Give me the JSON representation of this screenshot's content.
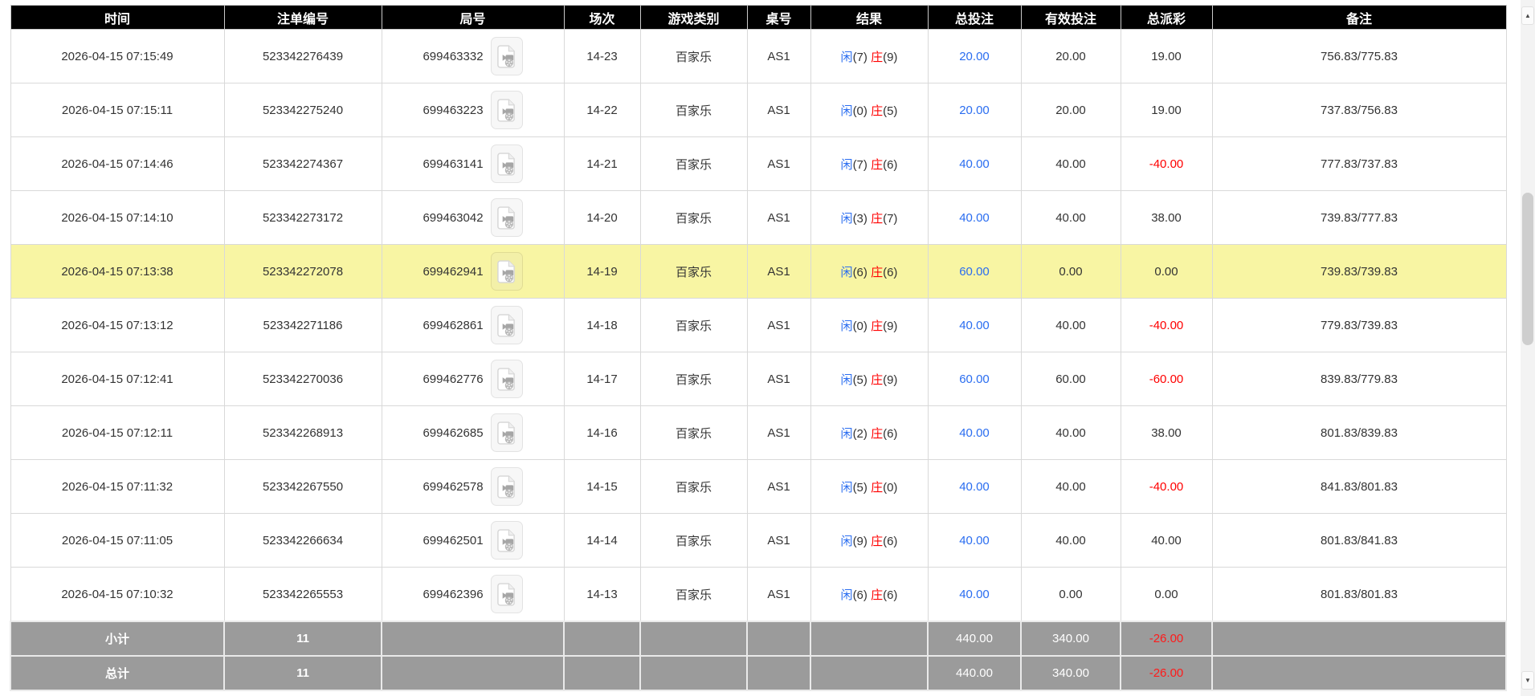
{
  "header": {
    "columns": [
      {
        "key": "time",
        "label": "时间"
      },
      {
        "key": "bet_id",
        "label": "注单编号"
      },
      {
        "key": "round_id",
        "label": "局号"
      },
      {
        "key": "session",
        "label": "场次"
      },
      {
        "key": "game_type",
        "label": "游戏类别"
      },
      {
        "key": "table_no",
        "label": "桌号"
      },
      {
        "key": "result",
        "label": "结果"
      },
      {
        "key": "total_bet",
        "label": "总投注"
      },
      {
        "key": "valid_bet",
        "label": "有效投注"
      },
      {
        "key": "total_payout",
        "label": "总派彩"
      },
      {
        "key": "remark",
        "label": "备注"
      }
    ]
  },
  "rows": [
    {
      "time": "2026-04-15 07:15:49",
      "bet_id": "523342276439",
      "round_id": "699463332",
      "session": "14-23",
      "game_type": "百家乐",
      "table_no": "AS1",
      "result": {
        "player": "闲",
        "player_score": "(7)",
        "banker": "庄",
        "banker_score": "(9)"
      },
      "total_bet": "20.00",
      "valid_bet": "20.00",
      "total_payout": "19.00",
      "remark": "756.83/775.83",
      "highlighted": false
    },
    {
      "time": "2026-04-15 07:15:11",
      "bet_id": "523342275240",
      "round_id": "699463223",
      "session": "14-22",
      "game_type": "百家乐",
      "table_no": "AS1",
      "result": {
        "player": "闲",
        "player_score": "(0)",
        "banker": "庄",
        "banker_score": "(5)"
      },
      "total_bet": "20.00",
      "valid_bet": "20.00",
      "total_payout": "19.00",
      "remark": "737.83/756.83",
      "highlighted": false
    },
    {
      "time": "2026-04-15 07:14:46",
      "bet_id": "523342274367",
      "round_id": "699463141",
      "session": "14-21",
      "game_type": "百家乐",
      "table_no": "AS1",
      "result": {
        "player": "闲",
        "player_score": "(7)",
        "banker": "庄",
        "banker_score": "(6)"
      },
      "total_bet": "40.00",
      "valid_bet": "40.00",
      "total_payout": "-40.00",
      "remark": "777.83/737.83",
      "highlighted": false
    },
    {
      "time": "2026-04-15 07:14:10",
      "bet_id": "523342273172",
      "round_id": "699463042",
      "session": "14-20",
      "game_type": "百家乐",
      "table_no": "AS1",
      "result": {
        "player": "闲",
        "player_score": "(3)",
        "banker": "庄",
        "banker_score": "(7)"
      },
      "total_bet": "40.00",
      "valid_bet": "40.00",
      "total_payout": "38.00",
      "remark": "739.83/777.83",
      "highlighted": false
    },
    {
      "time": "2026-04-15 07:13:38",
      "bet_id": "523342272078",
      "round_id": "699462941",
      "session": "14-19",
      "game_type": "百家乐",
      "table_no": "AS1",
      "result": {
        "player": "闲",
        "player_score": "(6)",
        "banker": "庄",
        "banker_score": "(6)"
      },
      "total_bet": "60.00",
      "valid_bet": "0.00",
      "total_payout": "0.00",
      "remark": "739.83/739.83",
      "highlighted": true
    },
    {
      "time": "2026-04-15 07:13:12",
      "bet_id": "523342271186",
      "round_id": "699462861",
      "session": "14-18",
      "game_type": "百家乐",
      "table_no": "AS1",
      "result": {
        "player": "闲",
        "player_score": "(0)",
        "banker": "庄",
        "banker_score": "(9)"
      },
      "total_bet": "40.00",
      "valid_bet": "40.00",
      "total_payout": "-40.00",
      "remark": "779.83/739.83",
      "highlighted": false
    },
    {
      "time": "2026-04-15 07:12:41",
      "bet_id": "523342270036",
      "round_id": "699462776",
      "session": "14-17",
      "game_type": "百家乐",
      "table_no": "AS1",
      "result": {
        "player": "闲",
        "player_score": "(5)",
        "banker": "庄",
        "banker_score": "(9)"
      },
      "total_bet": "60.00",
      "valid_bet": "60.00",
      "total_payout": "-60.00",
      "remark": "839.83/779.83",
      "highlighted": false
    },
    {
      "time": "2026-04-15 07:12:11",
      "bet_id": "523342268913",
      "round_id": "699462685",
      "session": "14-16",
      "game_type": "百家乐",
      "table_no": "AS1",
      "result": {
        "player": "闲",
        "player_score": "(2)",
        "banker": "庄",
        "banker_score": "(6)"
      },
      "total_bet": "40.00",
      "valid_bet": "40.00",
      "total_payout": "38.00",
      "remark": "801.83/839.83",
      "highlighted": false
    },
    {
      "time": "2026-04-15 07:11:32",
      "bet_id": "523342267550",
      "round_id": "699462578",
      "session": "14-15",
      "game_type": "百家乐",
      "table_no": "AS1",
      "result": {
        "player": "闲",
        "player_score": "(5)",
        "banker": "庄",
        "banker_score": "(0)"
      },
      "total_bet": "40.00",
      "valid_bet": "40.00",
      "total_payout": "-40.00",
      "remark": "841.83/801.83",
      "highlighted": false
    },
    {
      "time": "2026-04-15 07:11:05",
      "bet_id": "523342266634",
      "round_id": "699462501",
      "session": "14-14",
      "game_type": "百家乐",
      "table_no": "AS1",
      "result": {
        "player": "闲",
        "player_score": "(9)",
        "banker": "庄",
        "banker_score": "(6)"
      },
      "total_bet": "40.00",
      "valid_bet": "40.00",
      "total_payout": "40.00",
      "remark": "801.83/841.83",
      "highlighted": false
    },
    {
      "time": "2026-04-15 07:10:32",
      "bet_id": "523342265553",
      "round_id": "699462396",
      "session": "14-13",
      "game_type": "百家乐",
      "table_no": "AS1",
      "result": {
        "player": "闲",
        "player_score": "(6)",
        "banker": "庄",
        "banker_score": "(6)"
      },
      "total_bet": "40.00",
      "valid_bet": "0.00",
      "total_payout": "0.00",
      "remark": "801.83/801.83",
      "highlighted": false
    }
  ],
  "summary": [
    {
      "label": "小计",
      "count": "11",
      "total_bet": "440.00",
      "valid_bet": "340.00",
      "total_payout": "-26.00",
      "remark": ""
    },
    {
      "label": "总计",
      "count": "11",
      "total_bet": "440.00",
      "valid_bet": "340.00",
      "total_payout": "-26.00",
      "remark": ""
    }
  ],
  "scrollbar": {
    "up_arrow": "▲",
    "down_arrow": "▼"
  },
  "colors": {
    "header_bg": "#000000",
    "header_text": "#ffffff",
    "highlight_row": "#f8f5a3",
    "link_blue": "#2a6df0",
    "negative_red": "#ff0000",
    "summary_bg": "#9b9b9b",
    "gridline": "#d9d9d9"
  }
}
